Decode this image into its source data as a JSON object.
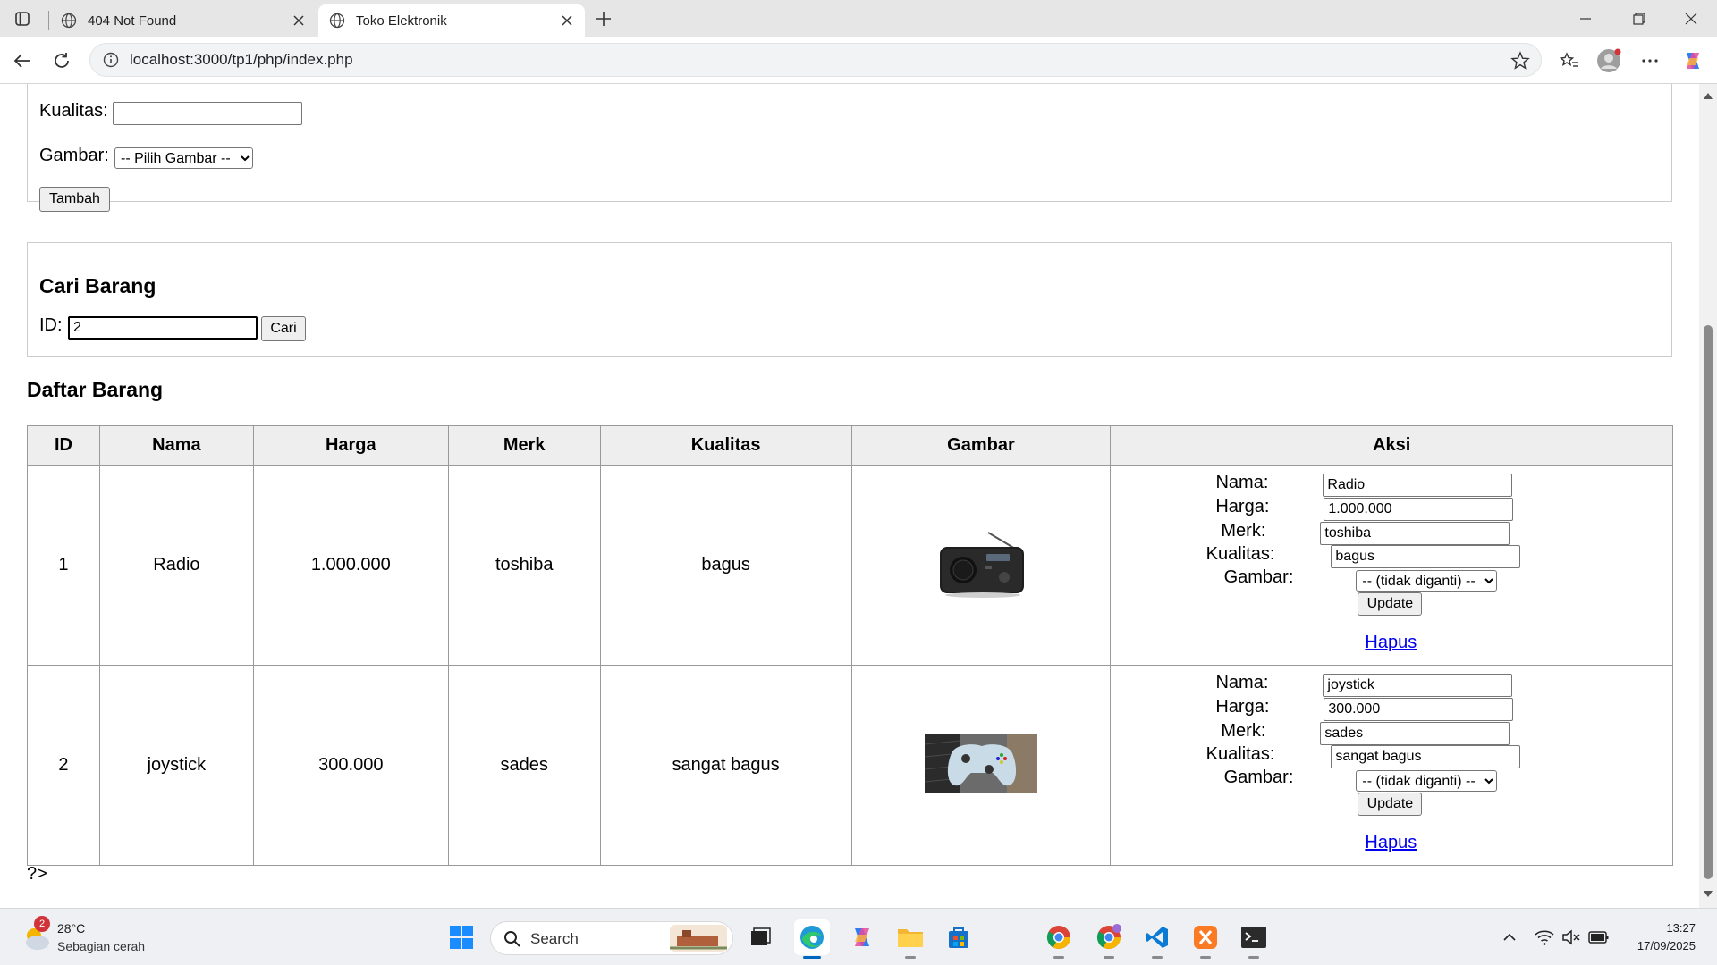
{
  "browser": {
    "tabs": [
      {
        "title": "404 Not Found",
        "active": false
      },
      {
        "title": "Toko Elektronik",
        "active": true
      }
    ],
    "url": "localhost:3000/tp1/php/index.php"
  },
  "add_form": {
    "kualitas_label": "Kualitas:",
    "kualitas_value": "",
    "gambar_label": "Gambar:",
    "gambar_selected": "-- Pilih Gambar --",
    "submit_label": "Tambah"
  },
  "search": {
    "heading": "Cari Barang",
    "id_label": "ID:",
    "id_value": "2",
    "button_label": "Cari"
  },
  "list": {
    "heading": "Daftar Barang",
    "columns": [
      "ID",
      "Nama",
      "Harga",
      "Merk",
      "Kualitas",
      "Gambar",
      "Aksi"
    ],
    "rows": [
      {
        "id": "1",
        "nama": "Radio",
        "harga": "1.000.000",
        "merk": "toshiba",
        "kualitas": "bagus",
        "image_icon": "radio-image",
        "edit": {
          "nama_label": "Nama:",
          "nama_value": "Radio",
          "harga_label": "Harga:",
          "harga_value": "1.000.000",
          "merk_label": "Merk:",
          "merk_value": "toshiba",
          "kualitas_label": "Kualitas:",
          "kualitas_value": "bagus",
          "gambar_label": "Gambar:",
          "gambar_selected": "-- (tidak diganti) --",
          "update_label": "Update",
          "hapus_label": "Hapus"
        }
      },
      {
        "id": "2",
        "nama": "joystick",
        "harga": "300.000",
        "merk": "sades",
        "kualitas": "sangat bagus",
        "image_icon": "joystick-image",
        "edit": {
          "nama_label": "Nama:",
          "nama_value": "joystick",
          "harga_label": "Harga:",
          "harga_value": "300.000",
          "merk_label": "Merk:",
          "merk_value": "sades",
          "kualitas_label": "Kualitas:",
          "kualitas_value": "sangat bagus",
          "gambar_label": "Gambar:",
          "gambar_selected": "-- (tidak diganti) --",
          "update_label": "Update",
          "hapus_label": "Hapus"
        }
      }
    ]
  },
  "trailing_text": "?>",
  "taskbar": {
    "weather_temp": "28°C",
    "weather_cond": "Sebagian cerah",
    "weather_badge": "2",
    "search_label": "Search",
    "time": "13:27",
    "date": "17/09/2025"
  },
  "colors": {
    "link": "#0000ee",
    "accent": "#0067c0",
    "table_border": "#999999",
    "header_bg": "#eeeeee"
  }
}
